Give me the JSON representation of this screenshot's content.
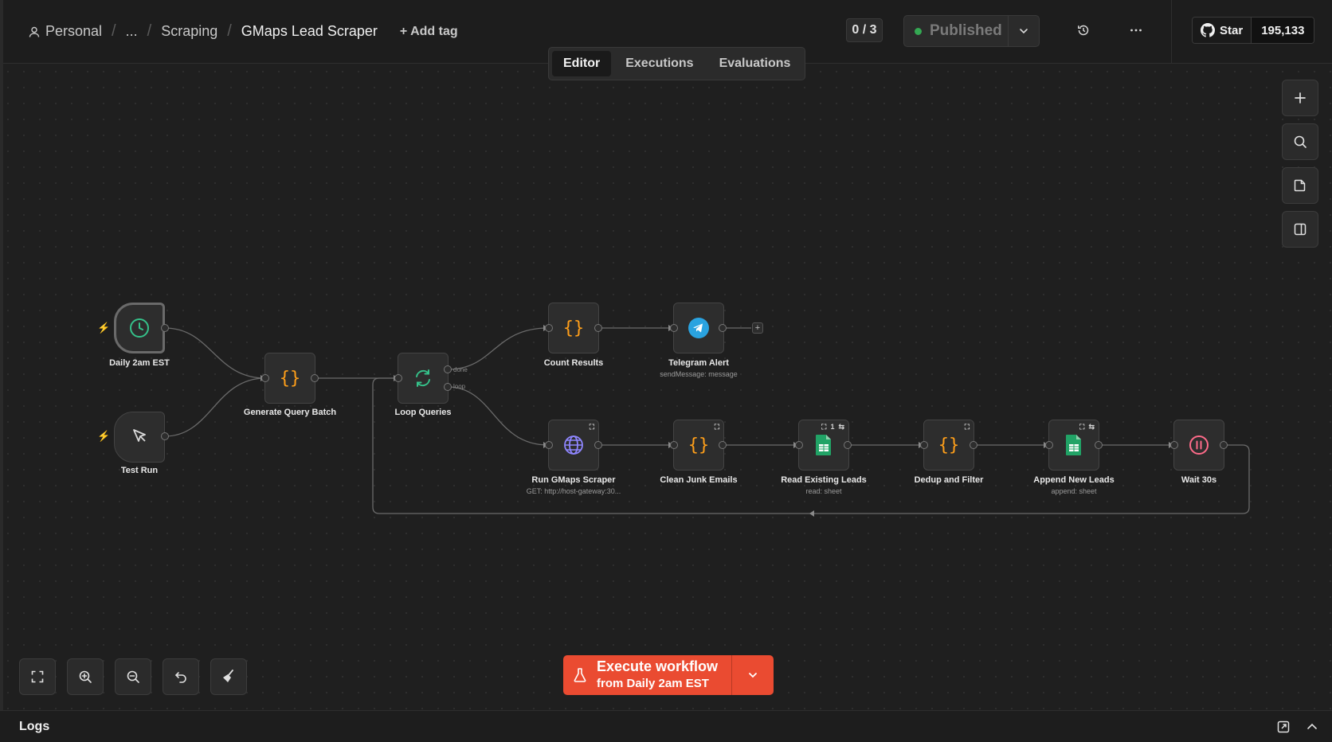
{
  "header": {
    "breadcrumb": {
      "owner": "Personal",
      "ellipsis": "...",
      "folder": "Scraping",
      "workflow": "GMaps Lead Scraper"
    },
    "add_tag": "+ Add tag",
    "counter": "0 / 3",
    "publish_label": "Published",
    "github": {
      "star_label": "Star",
      "star_count": "195,133"
    }
  },
  "tabs": [
    {
      "label": "Editor",
      "active": true
    },
    {
      "label": "Executions",
      "active": false
    },
    {
      "label": "Evaluations",
      "active": false
    }
  ],
  "nodes": {
    "daily": {
      "label": "Daily 2am EST",
      "icon": "clock-icon"
    },
    "test_run": {
      "label": "Test Run",
      "icon": "cursor-icon"
    },
    "generate": {
      "label": "Generate Query Batch",
      "icon": "code-braces-icon"
    },
    "loop": {
      "label": "Loop Queries",
      "icon": "refresh-icon",
      "ports": {
        "done": "done",
        "loop": "loop"
      }
    },
    "count": {
      "label": "Count Results",
      "icon": "code-braces-icon"
    },
    "telegram": {
      "label": "Telegram Alert",
      "sub": "sendMessage: message",
      "icon": "telegram-icon"
    },
    "gmaps": {
      "label": "Run GMaps Scraper",
      "sub": "GET: http://host-gateway:30...",
      "icon": "globe-icon"
    },
    "clean": {
      "label": "Clean Junk Emails",
      "icon": "code-braces-icon"
    },
    "read": {
      "label": "Read Existing Leads",
      "sub": "read: sheet",
      "icon": "sheets-icon",
      "badge": "1"
    },
    "dedup": {
      "label": "Dedup and Filter",
      "icon": "code-braces-icon"
    },
    "append": {
      "label": "Append New Leads",
      "sub": "append: sheet",
      "icon": "sheets-icon"
    },
    "wait": {
      "label": "Wait 30s",
      "icon": "pause-icon"
    }
  },
  "execute": {
    "line1": "Execute workflow",
    "line2": "from Daily 2am EST"
  },
  "logs": {
    "title": "Logs"
  },
  "colors": {
    "accent": "#ea4b31",
    "code_icon": "#ff9f1a",
    "clock_icon": "#35c28a",
    "globe_icon": "#8f86ff",
    "sheets": "#21a366",
    "wait_icon": "#ff6b8a",
    "telegram": "#2aa3e0",
    "published_dot": "#34a853"
  }
}
